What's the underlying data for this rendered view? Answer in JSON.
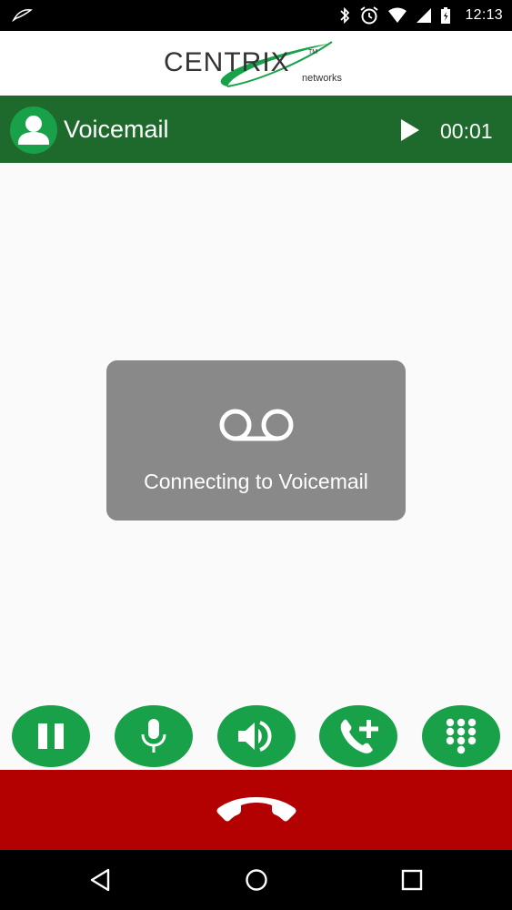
{
  "status_bar": {
    "time": "12:13",
    "icons": [
      "link-icon",
      "bluetooth-icon",
      "alarm-icon",
      "wifi-icon",
      "signal-icon",
      "battery-icon"
    ]
  },
  "logo": {
    "main": "CENTRIX",
    "tm": "TM",
    "sub": "networks"
  },
  "call": {
    "caller_name": "Voicemail",
    "timer": "00:01"
  },
  "toast": {
    "icon": "voicemail-icon",
    "message": "Connecting to Voicemail"
  },
  "controls": [
    {
      "name": "hold-button",
      "icon": "pause-icon"
    },
    {
      "name": "mute-button",
      "icon": "microphone-icon"
    },
    {
      "name": "speaker-button",
      "icon": "speaker-icon"
    },
    {
      "name": "add-call-button",
      "icon": "add-call-icon"
    },
    {
      "name": "keypad-button",
      "icon": "dialpad-icon"
    }
  ],
  "colors": {
    "header_green": "#1e6a2d",
    "button_green": "#19a14a",
    "end_call_red": "#b30000",
    "toast_gray": "#898989"
  }
}
